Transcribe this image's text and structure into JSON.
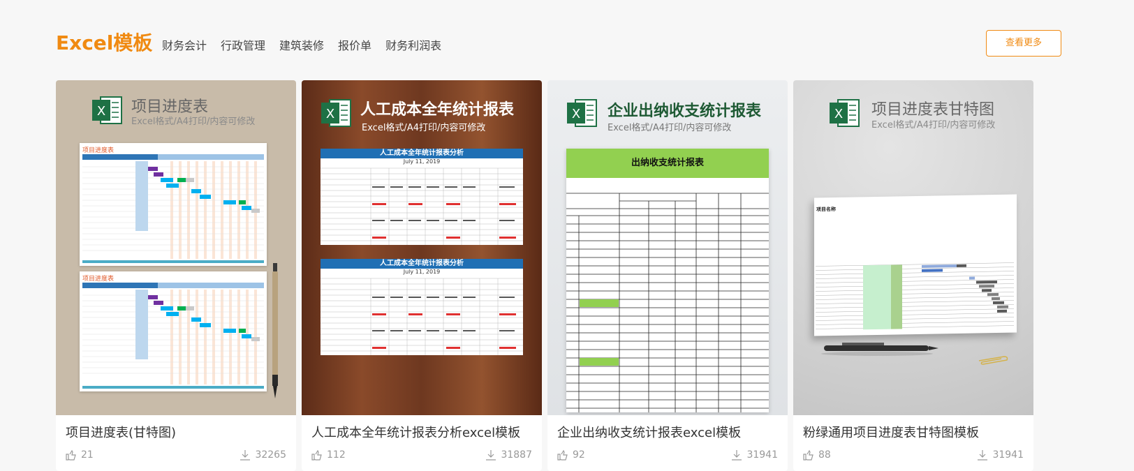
{
  "header": {
    "brand": "Excel模板",
    "categories": [
      "财务会计",
      "行政管理",
      "建筑装修",
      "报价单",
      "财务利润表"
    ],
    "more_label": "查看更多"
  },
  "cards": [
    {
      "thumb_title": "项目进度表",
      "thumb_sub": "Excel格式/A4打印/内容可修改",
      "sheet_title": "项目进度表",
      "title": "项目进度表(甘特图)",
      "likes": "21",
      "downloads": "32265"
    },
    {
      "thumb_title": "人工成本全年统计报表",
      "thumb_sub": "Excel格式/A4打印/内容可修改",
      "sheet_title": "人工成本全年统计报表分析",
      "sheet_date": "July 11, 2019",
      "title": "人工成本全年统计报表分析excel模板",
      "likes": "112",
      "downloads": "31887"
    },
    {
      "thumb_title": "企业出纳收支统计报表",
      "thumb_sub": "Excel格式/A4打印/内容可修改",
      "sheet_title": "出纳收支统计报表",
      "title": "企业出纳收支统计报表excel模板",
      "likes": "92",
      "downloads": "31941"
    },
    {
      "thumb_title": "项目进度表甘特图",
      "thumb_sub": "Excel格式/A4打印/内容可修改",
      "sheet_title": "项目名称",
      "title": "粉绿通用项目进度表甘特图模板",
      "likes": "88",
      "downloads": "31941"
    }
  ],
  "colors": {
    "accent": "#f08a12",
    "excel_green": "#1e7145"
  },
  "icons": [
    "thumbs-up-icon",
    "download-icon",
    "excel-icon"
  ]
}
